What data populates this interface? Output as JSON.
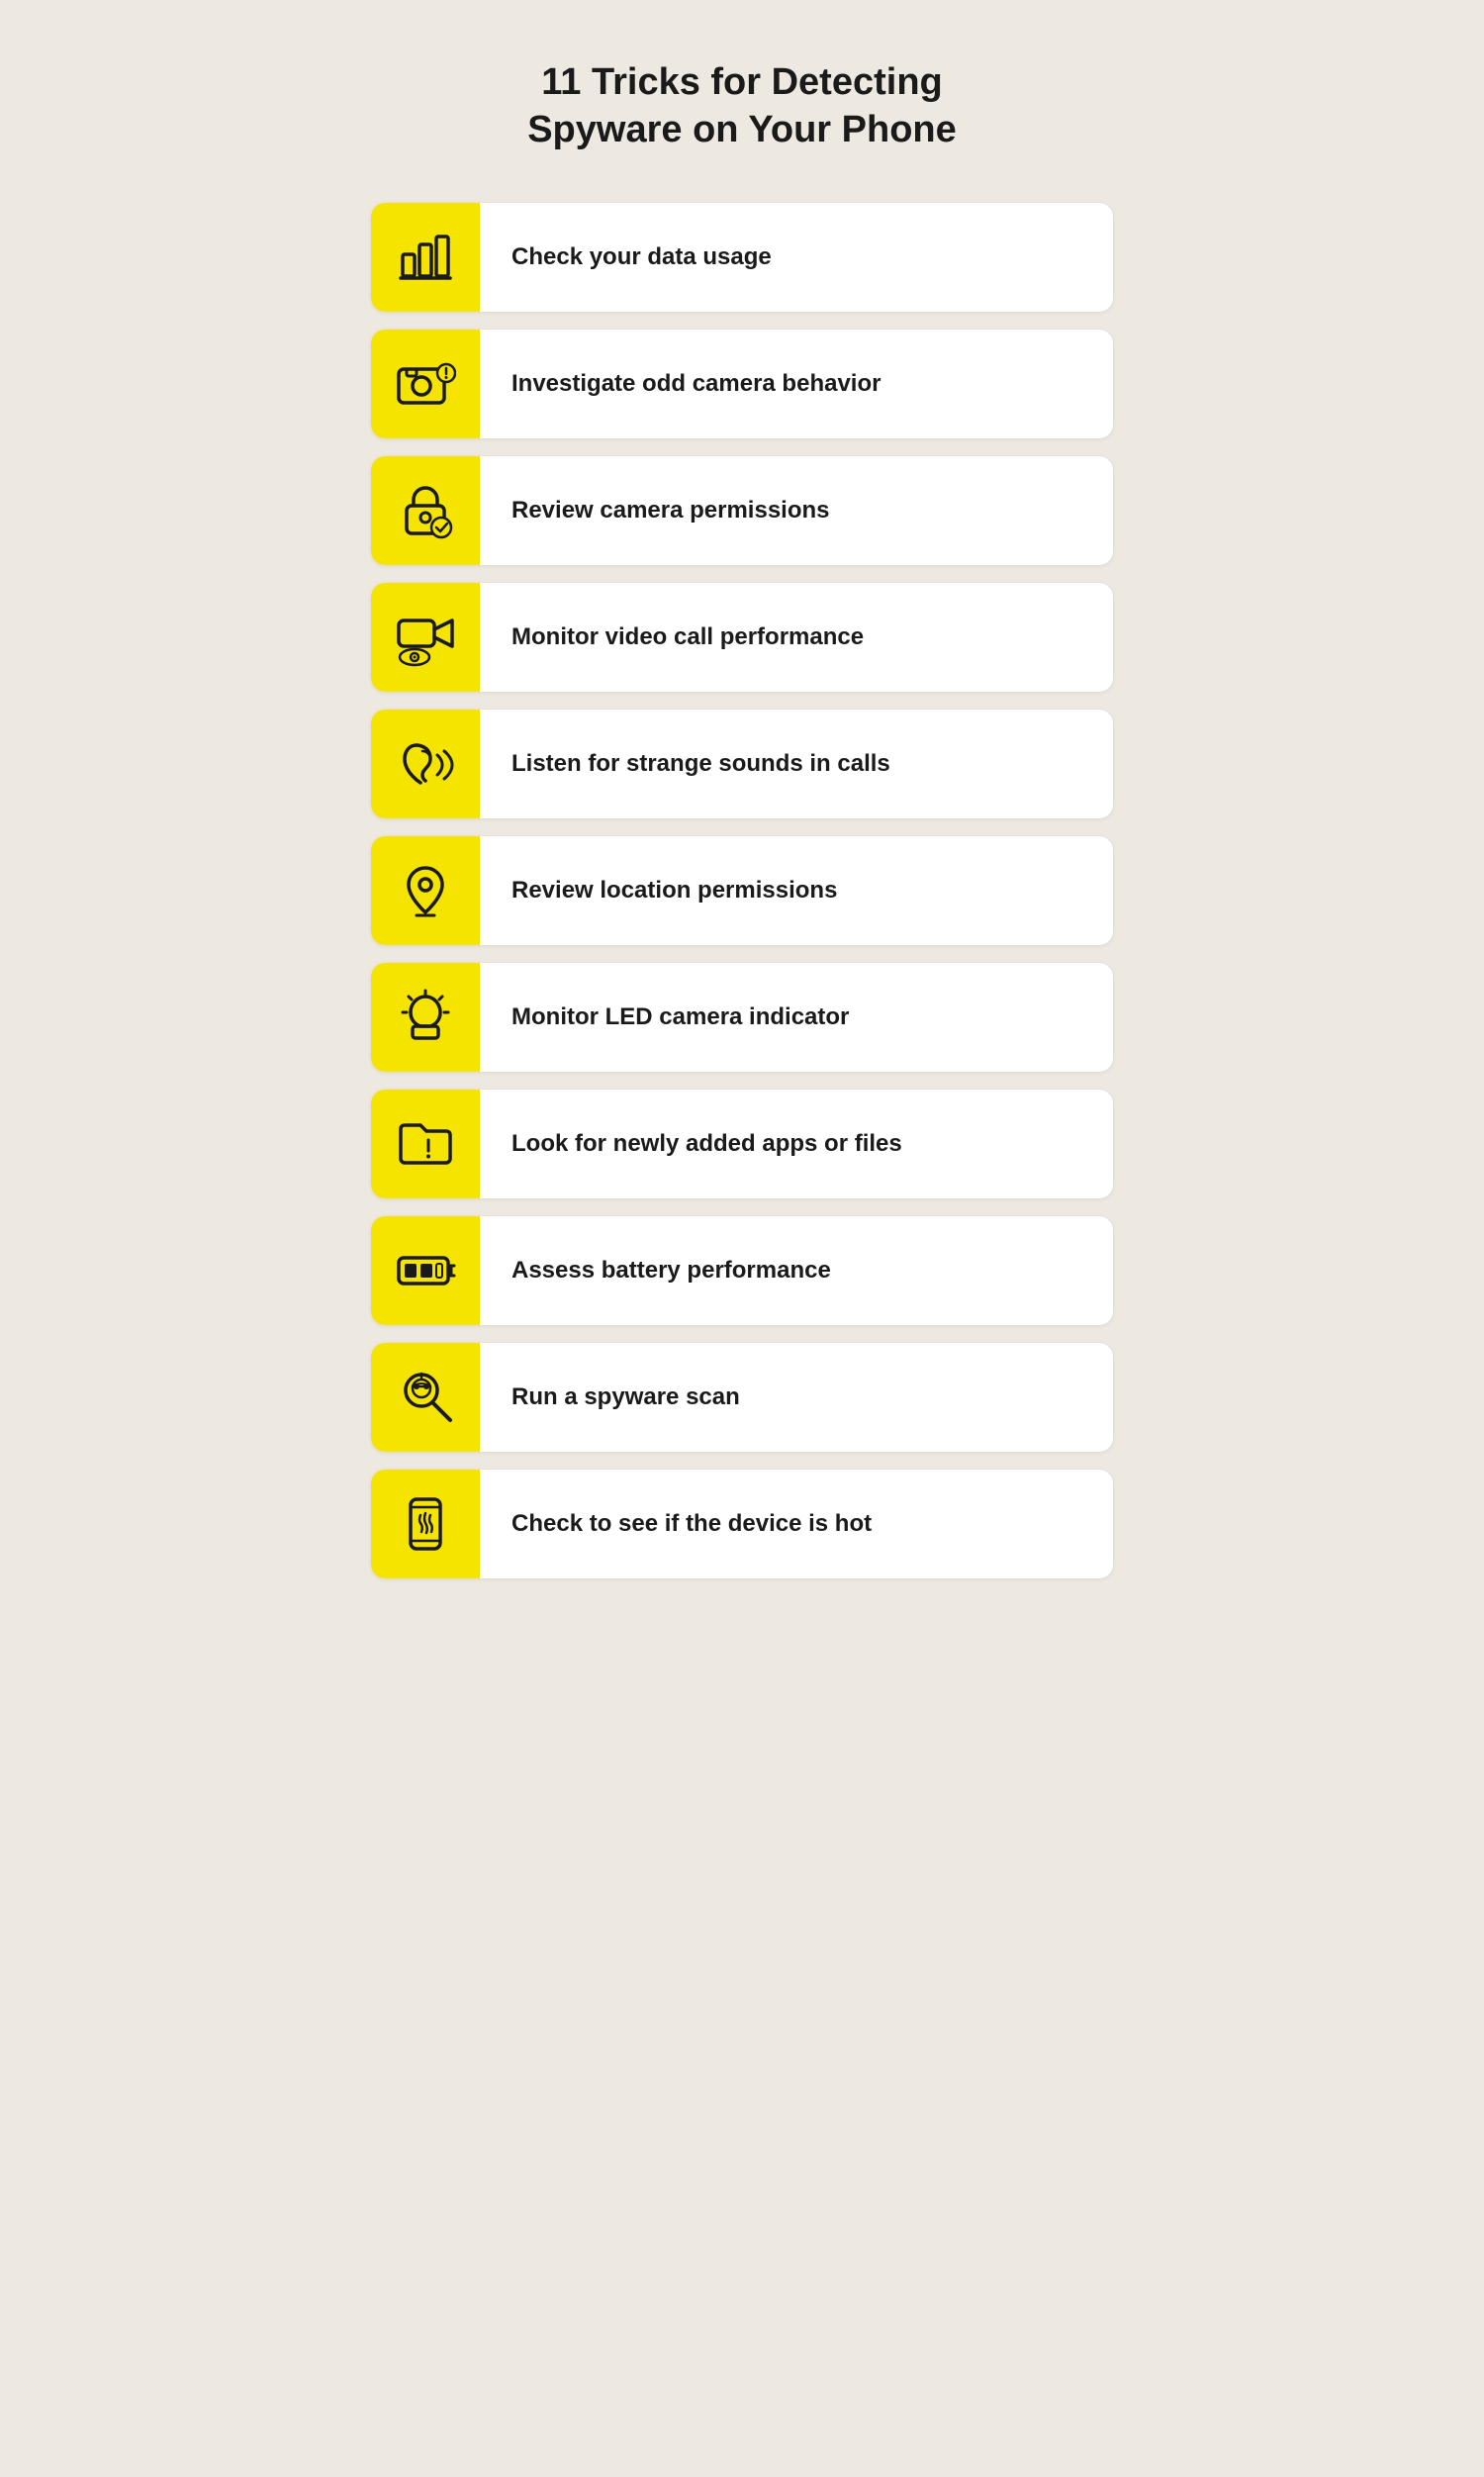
{
  "page": {
    "title_line1": "11 Tricks for Detecting",
    "title_line2": "Spyware on Your Phone"
  },
  "items": [
    {
      "id": "data-usage",
      "label": "Check your data usage",
      "icon": "bar-chart"
    },
    {
      "id": "camera-behavior",
      "label": "Investigate odd camera behavior",
      "icon": "camera-alert"
    },
    {
      "id": "camera-permissions",
      "label": "Review camera permissions",
      "icon": "lock-check"
    },
    {
      "id": "video-call",
      "label": "Monitor video call performance",
      "icon": "video-eye"
    },
    {
      "id": "sounds-calls",
      "label": "Listen for strange sounds in calls",
      "icon": "ear-sound"
    },
    {
      "id": "location-permissions",
      "label": "Review location permissions",
      "icon": "location-pin"
    },
    {
      "id": "led-indicator",
      "label": "Monitor LED camera indicator",
      "icon": "alarm-light"
    },
    {
      "id": "new-apps",
      "label": "Look for newly added apps or files",
      "icon": "folder-warning"
    },
    {
      "id": "battery",
      "label": "Assess battery performance",
      "icon": "battery-low"
    },
    {
      "id": "spyware-scan",
      "label": "Run a spyware scan",
      "icon": "spy-search"
    },
    {
      "id": "device-hot",
      "label": "Check to see if the device is hot",
      "icon": "phone-heat"
    }
  ]
}
